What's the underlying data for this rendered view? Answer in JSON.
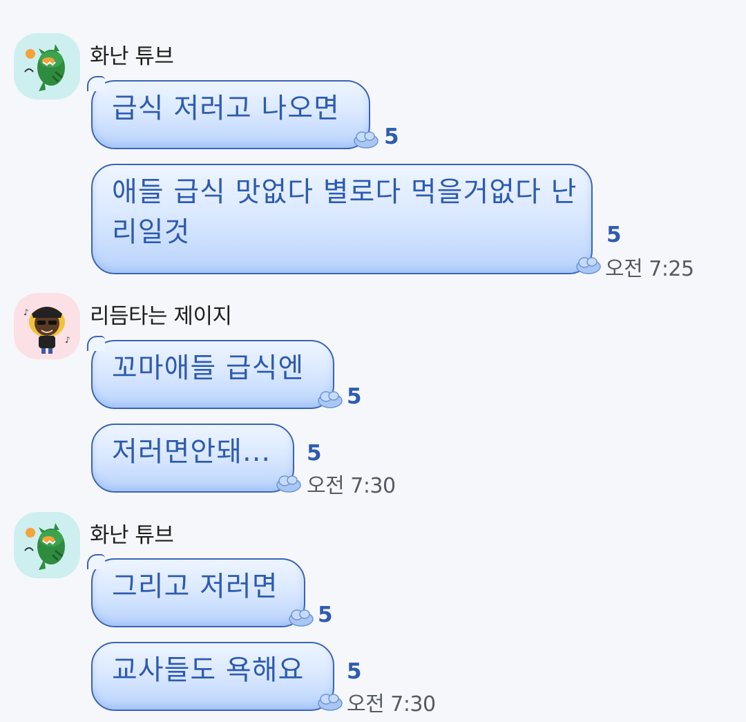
{
  "messages": [
    {
      "sender": "화난 튜브",
      "bubbles": [
        {
          "text": "급식 저러고 나오면",
          "unread": "5"
        },
        {
          "text": "애들 급식 맛없다 별로다 먹을거없다 난리일것",
          "unread": "5",
          "time": "오전 7:25"
        }
      ]
    },
    {
      "sender": "리듬타는 제이지",
      "bubbles": [
        {
          "text": "꼬마애들 급식엔",
          "unread": "5"
        },
        {
          "text": "저러면안돼...",
          "unread": "5",
          "time": "오전 7:30"
        }
      ]
    },
    {
      "sender": "화난 튜브",
      "bubbles": [
        {
          "text": "그리고 저러면",
          "unread": "5"
        },
        {
          "text": "교사들도 욕해요",
          "unread": "5",
          "time": "오전 7:30"
        }
      ]
    }
  ],
  "icons": {
    "bubble_decoration": "cloud-icon",
    "avatar_tube": "angry-tube-avatar-icon",
    "avatar_jayg": "rhythm-jayg-avatar-icon"
  },
  "colors": {
    "bubble_text": "#2d5bb0",
    "bubble_border": "#3a63b5",
    "background": "#f6f7fb"
  }
}
